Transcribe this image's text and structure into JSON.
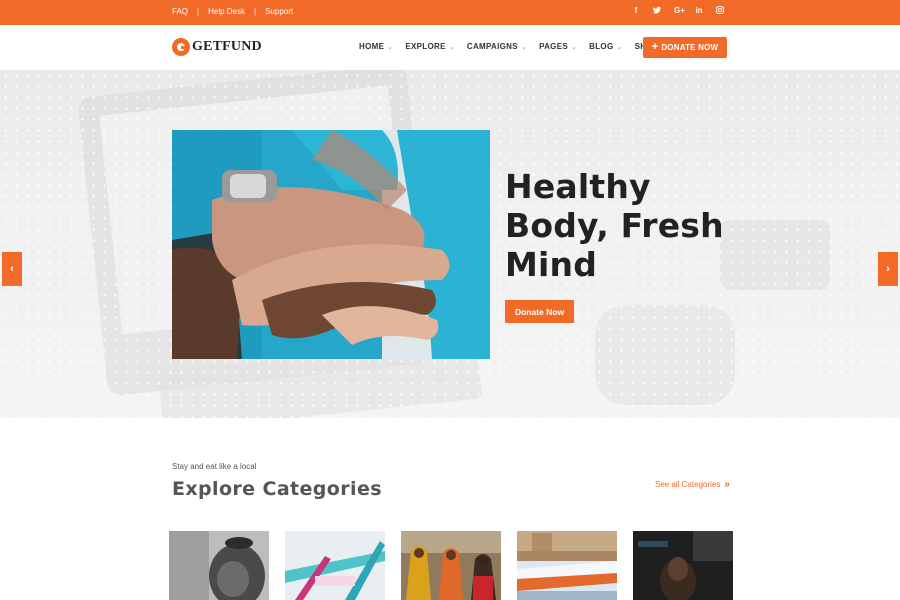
{
  "topbar": {
    "links": [
      "FAQ",
      "Help Desk",
      "Support"
    ],
    "separator": "|",
    "social_icons": [
      {
        "icon": "facebook-icon",
        "glyph": "f"
      },
      {
        "icon": "twitter-icon",
        "glyph": "t"
      },
      {
        "icon": "google-plus-icon",
        "glyph": "G+"
      },
      {
        "icon": "linkedin-icon",
        "glyph": "in"
      },
      {
        "icon": "instagram-icon",
        "glyph": "◎"
      }
    ],
    "color": "#f26a27"
  },
  "header": {
    "logo_text": "GETFUND",
    "nav": [
      {
        "label": "HOME"
      },
      {
        "label": "EXPLORE"
      },
      {
        "label": "CAMPAIGNS"
      },
      {
        "label": "PAGES"
      },
      {
        "label": "BLOG"
      },
      {
        "label": "SHOP"
      }
    ],
    "donate_button": "DONATE NOW",
    "donate_icon": "plus-icon"
  },
  "hero": {
    "title": "Healthy Body, Fresh Mind",
    "cta": "Donate Now",
    "prev_arrow": "‹",
    "next_arrow": "›",
    "accent": "#f26a27"
  },
  "categories": {
    "subtitle": "Stay and eat like a local",
    "title": "Explore Categories",
    "see_all": "See all Categories",
    "see_all_icon": "double-chevron-right-icon"
  }
}
